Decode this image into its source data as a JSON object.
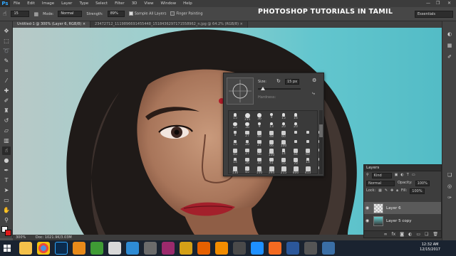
{
  "app": {
    "logo": "Ps"
  },
  "menubar": {
    "items": [
      "File",
      "Edit",
      "Image",
      "Layer",
      "Type",
      "Select",
      "Filter",
      "3D",
      "View",
      "Window",
      "Help"
    ],
    "controls": [
      "—",
      "❐",
      "✕"
    ]
  },
  "options_bar": {
    "brush_size": "15",
    "mode_label": "Mode:",
    "mode_value": "Normal",
    "strength_label": "Strength:",
    "strength_value": "89%",
    "sample_all_layers": "Sample All Layers",
    "finger_painting": "Finger Painting",
    "workspace": "Essentials"
  },
  "banner": "PHOTOSHOP TUTORIALS IN TAMIL",
  "tabs": [
    {
      "label": "Untitled-1 @ 300% (Layer 6, RGB/8) ×"
    },
    {
      "label": "23472712_1119896691455448_1518436297171558962_n.jpg @ 64.2% (RGB/8) ×"
    }
  ],
  "status": {
    "zoom": "300%",
    "doc": "Doc: 1021.9K/3.03M"
  },
  "brush_panel": {
    "size_label": "Size:",
    "size_value": "15 px",
    "hardness_label": "Hardness:",
    "presets": [
      [
        "15",
        "155",
        "36",
        "9",
        "15",
        "16"
      ],
      [
        "25",
        "36",
        "9",
        "13",
        "20",
        "20"
      ],
      [
        "8",
        "27",
        "48",
        "48",
        "60",
        "",
        "",
        ""
      ],
      [
        "15",
        "20",
        "27",
        "66",
        "100",
        "",
        "",
        ""
      ],
      [
        "45",
        "27",
        "66",
        "100",
        "14",
        "44",
        "60",
        ""
      ],
      [
        "14",
        "26",
        "33",
        "41",
        "55",
        "70",
        "14",
        ""
      ],
      [
        "130",
        "85",
        "100",
        "394",
        "215",
        "800",
        "413",
        ""
      ]
    ]
  },
  "layers_panel": {
    "title": "Layers",
    "kind": "Kind",
    "blend_mode": "Normal",
    "opacity_label": "Opacity:",
    "opacity_value": "100%",
    "lock_label": "Lock:",
    "fill_label": "Fill:",
    "fill_value": "100%",
    "layers": [
      {
        "name": "Layer 6",
        "selected": true
      },
      {
        "name": "Layer 5 copy",
        "selected": false
      }
    ],
    "bottom_icons": [
      "link-icon",
      "fx-icon",
      "mask-icon",
      "adjust-icon",
      "folder-icon",
      "new-layer-icon",
      "trash-icon"
    ]
  },
  "taskbar": {
    "time": "12:32 AM",
    "date": "12/15/2017",
    "apps": [
      "file-explorer",
      "chrome",
      "photoshop",
      "media-player",
      "camtasia",
      "paint",
      "chat",
      "cortana",
      "winrar-icon",
      "video",
      "firefox",
      "vlc",
      "network",
      "ie",
      "adobe-ai",
      "word",
      "camera",
      "screen"
    ]
  }
}
